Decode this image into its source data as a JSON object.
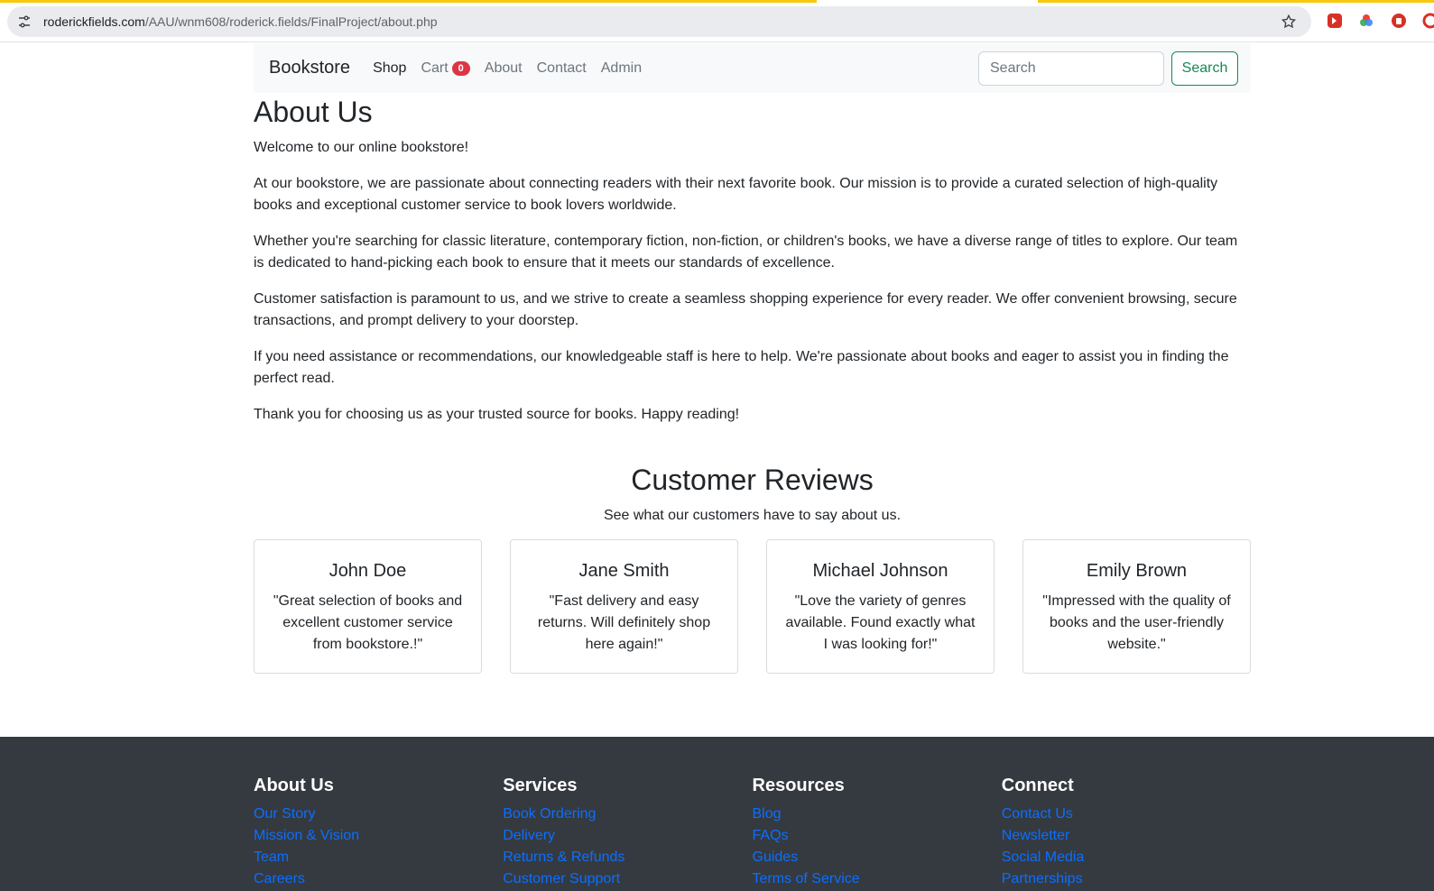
{
  "browser": {
    "url_host": "roderickfields.com",
    "url_path": "/AAU/wnm608/roderick.fields/FinalProject/about.php"
  },
  "navbar": {
    "brand": "Bookstore",
    "links": [
      {
        "label": "Shop",
        "active": true
      },
      {
        "label": "Cart",
        "badge": "0"
      },
      {
        "label": "About"
      },
      {
        "label": "Contact"
      },
      {
        "label": "Admin"
      }
    ],
    "search_placeholder": "Search",
    "search_button": "Search"
  },
  "about": {
    "title": "About Us",
    "paragraphs": [
      "Welcome to our online bookstore!",
      "At our bookstore, we are passionate about connecting readers with their next favorite book. Our mission is to provide a curated selection of high-quality books and exceptional customer service to book lovers worldwide.",
      "Whether you're searching for classic literature, contemporary fiction, non-fiction, or children's books, we have a diverse range of titles to explore. Our team is dedicated to hand-picking each book to ensure that it meets our standards of excellence.",
      "Customer satisfaction is paramount to us, and we strive to create a seamless shopping experience for every reader. We offer convenient browsing, secure transactions, and prompt delivery to your doorstep.",
      "If you need assistance or recommendations, our knowledgeable staff is here to help. We're passionate about books and eager to assist you in finding the perfect read.",
      "Thank you for choosing us as your trusted source for books. Happy reading!"
    ]
  },
  "reviews": {
    "title": "Customer Reviews",
    "subtitle": "See what our customers have to say about us.",
    "items": [
      {
        "name": "John Doe",
        "quote": "\"Great selection of books and excellent customer service from bookstore.!\""
      },
      {
        "name": "Jane Smith",
        "quote": "\"Fast delivery and easy returns. Will definitely shop here again!\""
      },
      {
        "name": "Michael Johnson",
        "quote": "\"Love the variety of genres available. Found exactly what I was looking for!\""
      },
      {
        "name": "Emily Brown",
        "quote": "\"Impressed with the quality of books and the user-friendly website.\""
      }
    ]
  },
  "footer": {
    "columns": [
      {
        "heading": "About Us",
        "links": [
          "Our Story",
          "Mission & Vision",
          "Team",
          "Careers"
        ]
      },
      {
        "heading": "Services",
        "links": [
          "Book Ordering",
          "Delivery",
          "Returns & Refunds",
          "Customer Support"
        ]
      },
      {
        "heading": "Resources",
        "links": [
          "Blog",
          "FAQs",
          "Guides",
          "Terms of Service"
        ]
      },
      {
        "heading": "Connect",
        "links": [
          "Contact Us",
          "Newsletter",
          "Social Media",
          "Partnerships"
        ]
      }
    ]
  },
  "colors": {
    "accent_link": "#0d6efd",
    "search_green": "#198754",
    "badge_red": "#dc3545",
    "footer_bg": "#343a40",
    "navbar_bg": "#f8f9fa"
  },
  "icons": [
    "site-info-icon",
    "star-icon",
    "extension-icons"
  ]
}
